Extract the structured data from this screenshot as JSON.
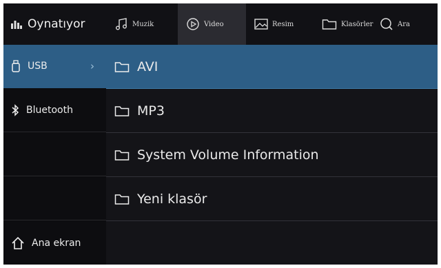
{
  "now_playing": {
    "label": "Oynatıyor",
    "icon": "equalizer-icon"
  },
  "tabs": [
    {
      "label": "Muzik",
      "icon": "music-note-icon",
      "active": false
    },
    {
      "label": "Video",
      "icon": "play-circle-icon",
      "active": true
    },
    {
      "label": "Resim",
      "icon": "image-icon",
      "active": false
    },
    {
      "label": "Klasörler",
      "icon": "folder-icon",
      "active": false
    },
    {
      "label": "Ara",
      "icon": "search-icon",
      "active": false
    }
  ],
  "sidebar": {
    "items": [
      {
        "label": "USB",
        "icon": "usb-icon",
        "selected": true
      },
      {
        "label": "Bluetooth",
        "icon": "bluetooth-icon",
        "selected": false
      },
      {
        "label": "",
        "selected": false
      },
      {
        "label": "",
        "selected": false
      },
      {
        "label": "Ana ekran",
        "icon": "home-icon",
        "selected": false
      }
    ]
  },
  "folders": [
    {
      "name": "AVI",
      "selected": true
    },
    {
      "name": "MP3",
      "selected": false
    },
    {
      "name": "System Volume Information",
      "selected": false
    },
    {
      "name": "Yeni klasör",
      "selected": false
    }
  ],
  "colors": {
    "accent": "#2d5e86",
    "background": "#0b0b0d",
    "active_tab": "#2b2b31"
  }
}
